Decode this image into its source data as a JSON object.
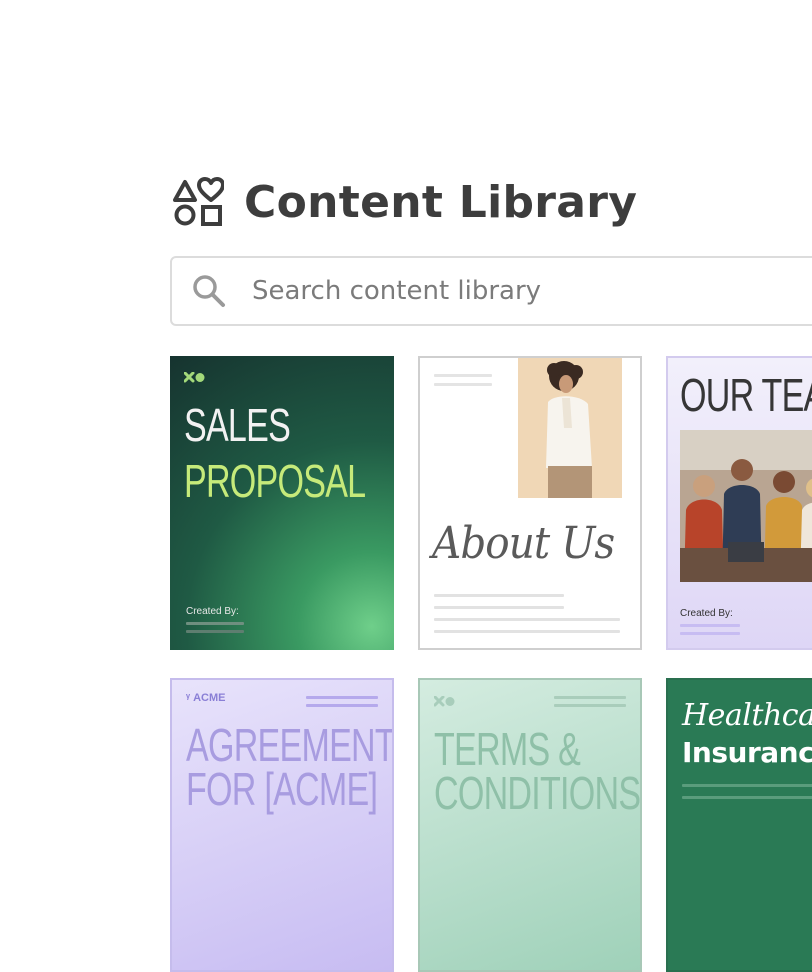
{
  "header": {
    "title": "Content Library",
    "icon": "shapes-library-icon"
  },
  "search": {
    "placeholder": "Search content library",
    "icon": "search-icon"
  },
  "templates": [
    {
      "lines": [
        "SALES",
        "PROPOSAL"
      ],
      "created_label": "Created By:",
      "colors": {
        "line1": "#f2f2f2",
        "line2": "#c6ea7a"
      }
    },
    {
      "lines": [
        "About Us"
      ]
    },
    {
      "lines": [
        "OUR TEAM"
      ],
      "created_label": "Created By:"
    },
    {
      "brand": "ACME",
      "lines": [
        "AGREEMENT",
        "FOR [ACME]"
      ]
    },
    {
      "lines": [
        "TERMS &",
        "CONDITIONS"
      ]
    },
    {
      "lines": [
        "Healthcare",
        "Insurance"
      ]
    }
  ],
  "colors": {
    "title": "#3d3d3d",
    "search_border": "#dcdcdc",
    "sales_bg": "#16332f",
    "agreement_bg": "#c7bcf2",
    "terms_bg": "#9fd1b9",
    "healthcare_bg": "#2a7a55"
  }
}
